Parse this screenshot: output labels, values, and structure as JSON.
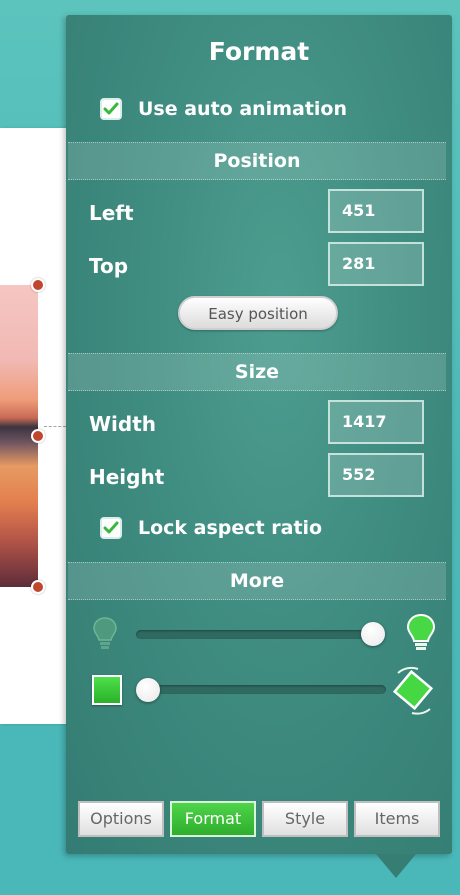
{
  "panel": {
    "title": "Format",
    "auto_animation": {
      "label": "Use auto animation",
      "checked": true
    },
    "sections": {
      "position": "Position",
      "size": "Size",
      "more": "More"
    },
    "position": {
      "left_label": "Left",
      "left_value": "451",
      "top_label": "Top",
      "top_value": "281",
      "easy_button": "Easy position"
    },
    "size": {
      "width_label": "Width",
      "width_value": "1417",
      "height_label": "Height",
      "height_value": "552",
      "lock_aspect": {
        "label": "Lock aspect ratio",
        "checked": true
      }
    },
    "more": {
      "brightness_slider": {
        "value": 1.0,
        "icon_low": "lightbulb-off-icon",
        "icon_high": "lightbulb-on-icon"
      },
      "rotation_slider": {
        "value": 0.0,
        "icon_low": "square-icon",
        "icon_high": "rotated-square-icon"
      }
    },
    "tabs": [
      "Options",
      "Format",
      "Style",
      "Items"
    ],
    "active_tab": "Format"
  },
  "colors": {
    "accent_green": "#3cc63a",
    "panel": "#3f8c80"
  }
}
